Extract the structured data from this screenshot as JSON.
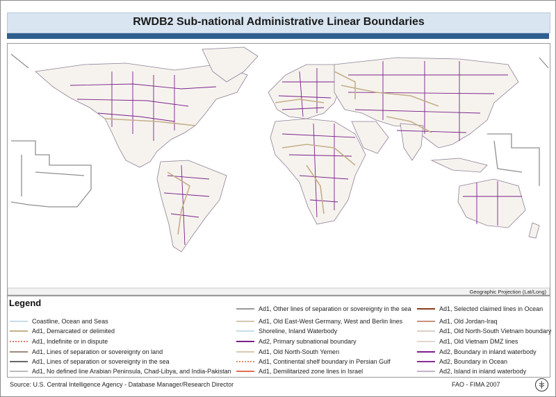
{
  "title": "RWDB2 Sub-national Administrative Linear Boundaries",
  "projection_note": "Geographic Projection (Lat/Long)",
  "legend": {
    "title": "Legend",
    "col1": [
      {
        "label": "Coastline, Ocean and Seas",
        "color": "#c8dcea",
        "style": "solid"
      },
      {
        "label": "Ad1, Demarcated or delimited",
        "color": "#c4ae88",
        "style": "solid"
      },
      {
        "label": "Ad1, Indefinite or in dispute",
        "color": "#d87a6a",
        "style": "dotted"
      },
      {
        "label": "Ad1, Lines of separation or sovereignty on land",
        "color": "#a0887a",
        "style": "solid"
      },
      {
        "label": "Ad1, Lines of separation or sovereignty in the sea",
        "color": "#666666",
        "style": "solid"
      },
      {
        "label": "Ad1, No defined line Arabian Peninsula, Chad-Libya, and India-Pakistan",
        "color": "#bbbbbb",
        "style": "solid"
      }
    ],
    "col2": [
      {
        "label": "Ad1, Other lines of separation or sovereignty in the sea",
        "color": "#999999",
        "style": "solid"
      },
      {
        "label": "Ad1, Old East-West Germany, West and Berlin lines",
        "color": "#d4c8b0",
        "style": "solid"
      },
      {
        "label": "Shoreline, Inland Waterbody",
        "color": "#c8dcea",
        "style": "solid"
      },
      {
        "label": "Ad2, Primary subnational boundary",
        "color": "#7a1f8a",
        "style": "solid"
      },
      {
        "label": "Ad1, Old North-South Yemen",
        "color": "#d8c8b0",
        "style": "solid"
      },
      {
        "label": "Ad1, Continental shelf boundary in Persian Gulf",
        "color": "#d88a6a",
        "style": "dotted"
      },
      {
        "label": "Ad1, Demilitarized zone lines in Israel",
        "color": "#e07050",
        "style": "solid"
      }
    ],
    "col3": [
      {
        "label": "Ad1, Selected claimed lines in Ocean",
        "color": "#8a3a1a",
        "style": "solid"
      },
      {
        "label": "Ad1, Old Jordan-Iraq",
        "color": "#c89080",
        "style": "solid"
      },
      {
        "label": "Ad1, Old North-South Vietnam boundary",
        "color": "#d8d0c8",
        "style": "solid"
      },
      {
        "label": "Ad1, Old Vietnam DMZ lines",
        "color": "#e0d8d0",
        "style": "solid"
      },
      {
        "label": "Ad2, Boundary in inland waterbody",
        "color": "#7a1f8a",
        "style": "solid"
      },
      {
        "label": "Ad2, Boundary in Ocean",
        "color": "#8a2a9a",
        "style": "solid"
      },
      {
        "label": "Ad2, Island in inland waterbody",
        "color": "#c0b0c8",
        "style": "solid"
      }
    ]
  },
  "footer": {
    "source": "Source: U.S. Central Intelligence Agency - Database Manager/Research Director",
    "credit": "FAO - FIMA 2007"
  }
}
